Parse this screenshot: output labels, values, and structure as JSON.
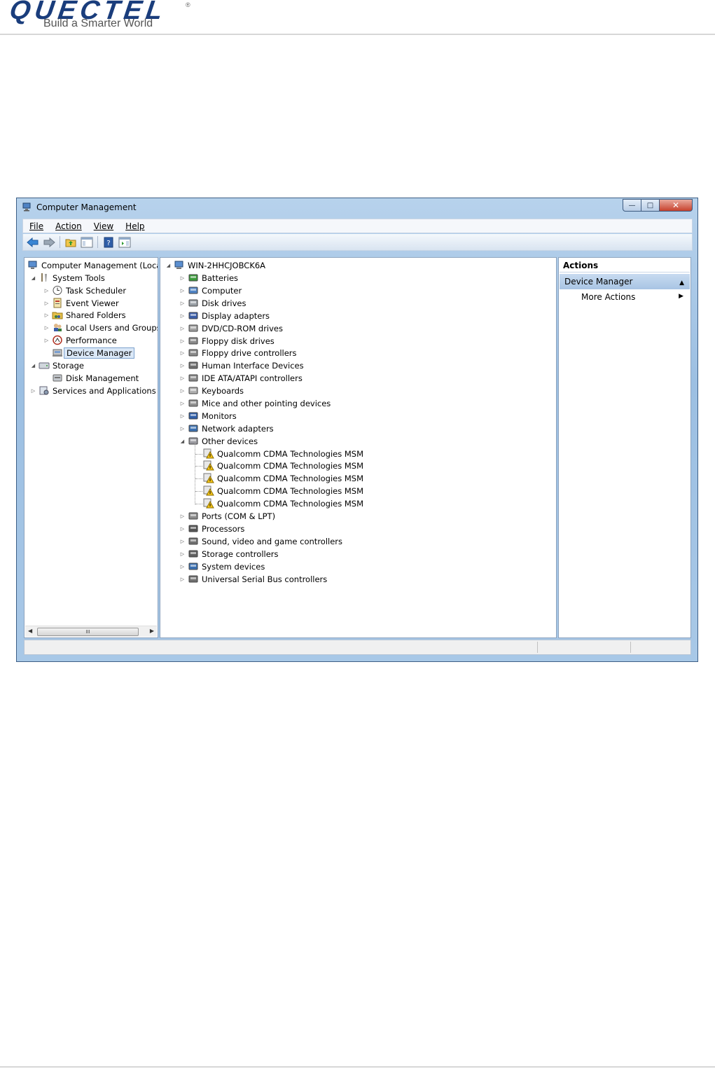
{
  "header": {
    "logo": "QUECTEL",
    "tagline": "Build a Smarter World",
    "reg": "®"
  },
  "window": {
    "title": "Computer Management",
    "caption": {
      "minimize": "—",
      "maximize": "□",
      "close": "✕"
    },
    "menu": [
      "File",
      "Action",
      "View",
      "Help"
    ],
    "toolbar_icons": [
      "back-icon",
      "forward-icon",
      "up-folder-icon",
      "show-hide-tree-icon",
      "help-icon",
      "show-hide-action-pane-icon"
    ]
  },
  "left_tree": {
    "root": "Computer Management (Local",
    "system_tools": "System Tools",
    "task_scheduler": "Task Scheduler",
    "event_viewer": "Event Viewer",
    "shared_folders": "Shared Folders",
    "local_users": "Local Users and Groups",
    "performance": "Performance",
    "device_manager": "Device Manager",
    "storage": "Storage",
    "disk_management": "Disk Management",
    "services": "Services and Applications",
    "scroll_grip": "III"
  },
  "device_tree": {
    "computer_name": "WIN-2HHCJOBCK6A",
    "categories": [
      "Batteries",
      "Computer",
      "Disk drives",
      "Display adapters",
      "DVD/CD-ROM drives",
      "Floppy disk drives",
      "Floppy drive controllers",
      "Human Interface Devices",
      "IDE ATA/ATAPI controllers",
      "Keyboards",
      "Mice and other pointing devices",
      "Monitors",
      "Network adapters",
      "Other devices"
    ],
    "other_devices": [
      "Qualcomm CDMA Technologies MSM",
      "Qualcomm CDMA Technologies MSM",
      "Qualcomm CDMA Technologies MSM",
      "Qualcomm CDMA Technologies MSM",
      "Qualcomm CDMA Technologies MSM"
    ],
    "categories_after": [
      "Ports (COM & LPT)",
      "Processors",
      "Sound, video and game controllers",
      "Storage controllers",
      "System devices",
      "Universal Serial Bus controllers"
    ]
  },
  "actions_pane": {
    "title": "Actions",
    "section": "Device Manager",
    "more_actions": "More Actions"
  }
}
